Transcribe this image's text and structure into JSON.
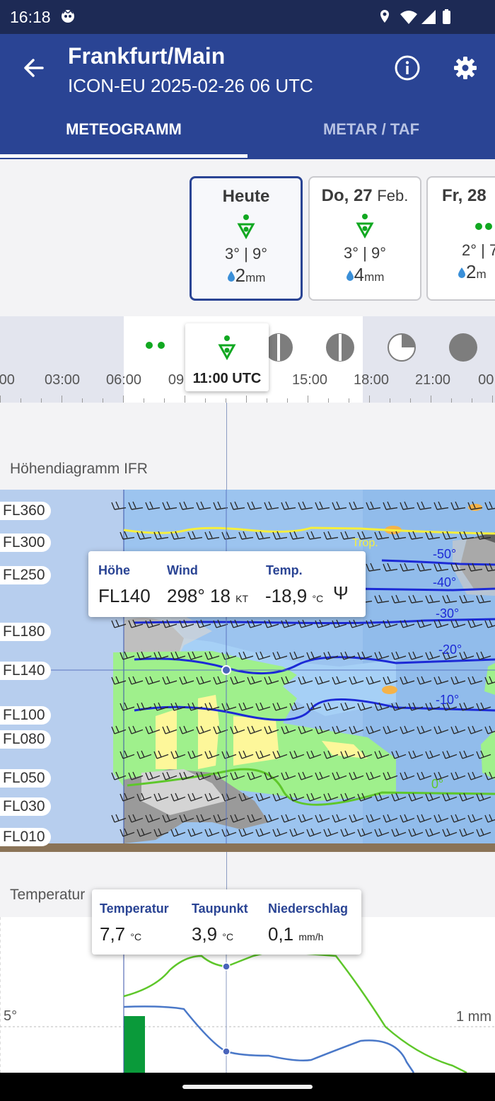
{
  "status_bar": {
    "time": "16:18"
  },
  "header": {
    "title": "Frankfurt/Main",
    "subtitle": "ICON-EU 2025-02-26 06 UTC"
  },
  "tabs": [
    {
      "label": "METEOGRAMM",
      "selected": true
    },
    {
      "label": "METAR / TAF",
      "selected": false
    }
  ],
  "day_cards": [
    {
      "day": "Heute",
      "month": "",
      "temps": "3° | 9°",
      "precip": "2",
      "unit": "mm",
      "selected": true
    },
    {
      "day": "Do, 27",
      "month": "Feb.",
      "temps": "3° | 9°",
      "precip": "4",
      "unit": "mm",
      "selected": false
    },
    {
      "day": "Fr, 28",
      "month": "",
      "temps": "2° | 7",
      "precip": "2",
      "unit": "m",
      "selected": false
    }
  ],
  "timeline": {
    "ticks": [
      ":00",
      "03:00",
      "06:00",
      "09",
      "15:00",
      "18:00",
      "21:00",
      "00:"
    ],
    "selected_label": "11:00 UTC"
  },
  "altitude_chart": {
    "title": "Höhendiagramm IFR",
    "levels": [
      "FL360",
      "FL300",
      "FL250",
      "FL180",
      "FL140",
      "FL100",
      "FL080",
      "FL050",
      "FL030",
      "FL010"
    ],
    "isotherms": [
      "-50°",
      "-40°",
      "-30°",
      "-20°",
      "-10°",
      "0°"
    ],
    "tropo_label": "Trop.",
    "tooltip": {
      "height_label": "Höhe",
      "height": "FL140",
      "wind_label": "Wind",
      "wind": "298° 18",
      "wind_unit": "KT",
      "temp_label": "Temp.",
      "temp": "-18,9",
      "temp_unit": "°C",
      "icing_symbol": "Ψ"
    }
  },
  "temperature_chart": {
    "title": "Temperatur",
    "axis_left": "5°",
    "axis_right": "1 mm",
    "tooltip": {
      "temp_label": "Temperatur",
      "temp": "7,7",
      "temp_unit": "°C",
      "dew_label": "Taupunkt",
      "dew": "3,9",
      "dew_unit": "°C",
      "precip_label": "Niederschlag",
      "precip": "0,1",
      "precip_unit": "mm/h"
    }
  },
  "colors": {
    "primary": "#2a4494",
    "status": "#1d2a55",
    "temp_line": "#5ec72a",
    "dew_line": "#4a78c8",
    "precip_bar": "#0a9a3a"
  }
}
